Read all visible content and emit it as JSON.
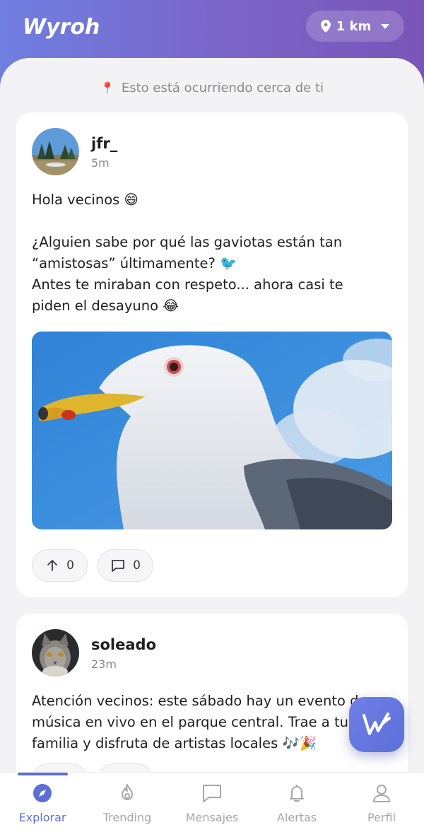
{
  "header": {
    "app_name": "Wyroh",
    "radius_label": "1 km"
  },
  "banner": {
    "text": "Esto está ocurriendo cerca de ti"
  },
  "posts": [
    {
      "author": "jfr_",
      "time": "5m",
      "lines": [
        "Hola vecinos 😄",
        "",
        "¿Alguien sabe por qué las gaviotas están tan",
        "“amistosas” últimamente? 🐦",
        "Antes te miraban con respeto... ahora casi te",
        "piden el desayuno 😂"
      ],
      "upvotes": "0",
      "comments": "0"
    },
    {
      "author": "soleado",
      "time": "23m",
      "lines": [
        "Atención vecinos: este sábado hay un evento de",
        "música en vivo en el parque central. Trae a tu",
        "familia y disfruta de artistas locales 🎶🎉"
      ]
    }
  ],
  "nav": {
    "items": [
      {
        "label": "Explorar",
        "icon": "compass-icon",
        "active": true
      },
      {
        "label": "Trending",
        "icon": "flame-icon",
        "active": false
      },
      {
        "label": "Mensajes",
        "icon": "message-icon",
        "active": false
      },
      {
        "label": "Alertas",
        "icon": "bell-icon",
        "active": false
      },
      {
        "label": "Perfil",
        "icon": "user-icon",
        "active": false
      }
    ]
  },
  "colors": {
    "accent": "#5b6fd8",
    "header_gradient_start": "#6f7fe0",
    "header_gradient_end": "#7a55b8",
    "background": "#f3f3f5"
  }
}
